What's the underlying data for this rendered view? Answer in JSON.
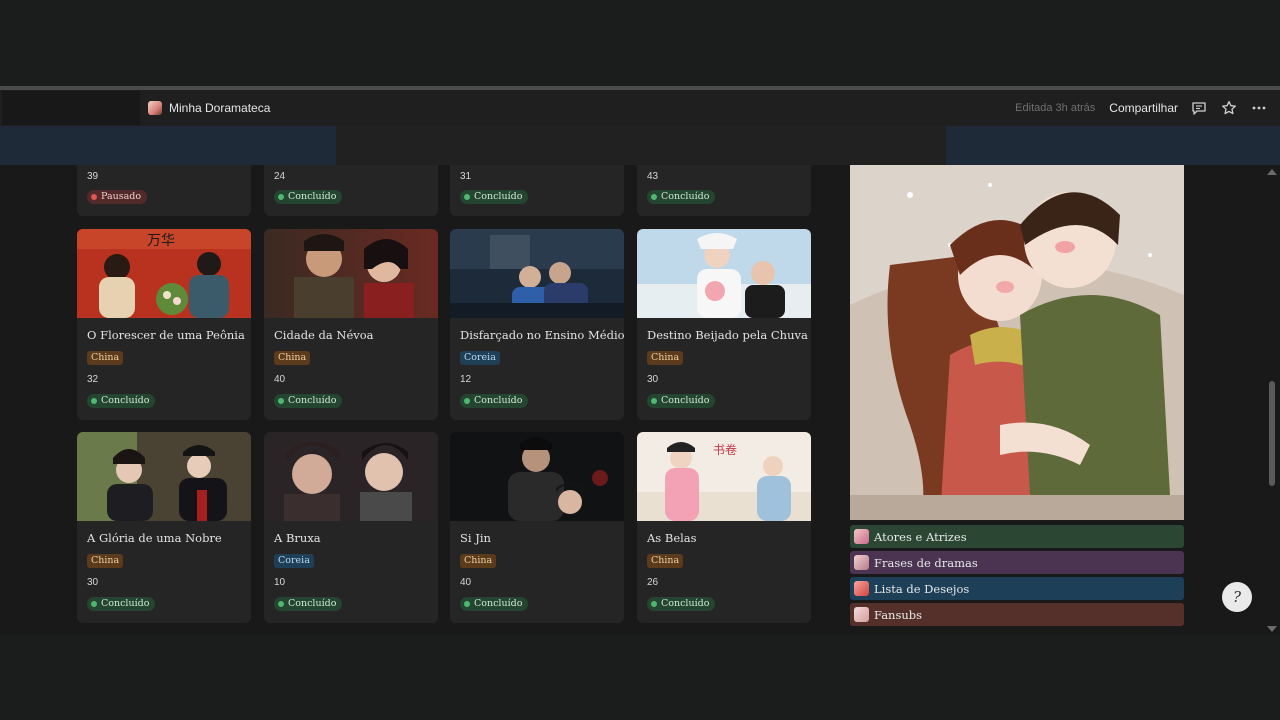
{
  "header": {
    "page_title": "Minha Doramateca",
    "edited": "Editada 3h atrás",
    "share": "Compartilhar"
  },
  "icons": [
    "page-icon",
    "comment-icon",
    "star-icon",
    "more-icon",
    "help-icon"
  ],
  "colors": {
    "status_done": "#24452f",
    "status_paused": "#522a2a",
    "country_china": "#5b3b1c",
    "country_korea": "#1f3f57"
  },
  "partial_cards": [
    {
      "episodes": "39",
      "status": "Pausado"
    },
    {
      "episodes": "24",
      "status": "Concluído"
    },
    {
      "episodes": "31",
      "status": "Concluído"
    },
    {
      "episodes": "43",
      "status": "Concluído"
    }
  ],
  "cards": [
    {
      "title": "O Florescer de uma Peônia",
      "country": "China",
      "episodes": "32",
      "status": "Concluído"
    },
    {
      "title": "Cidade da Névoa",
      "country": "China",
      "episodes": "40",
      "status": "Concluído"
    },
    {
      "title": "Disfarçado no Ensino Médio",
      "country": "Coreia",
      "episodes": "12",
      "status": "Concluído"
    },
    {
      "title": "Destino Beijado pela Chuva",
      "country": "China",
      "episodes": "30",
      "status": "Concluído"
    },
    {
      "title": "A Glória de uma Nobre",
      "country": "China",
      "episodes": "30",
      "status": "Concluído"
    },
    {
      "title": "A Bruxa",
      "country": "Coreia",
      "episodes": "10",
      "status": "Concluído"
    },
    {
      "title": "Si Jin",
      "country": "China",
      "episodes": "40",
      "status": "Concluído"
    },
    {
      "title": "As Belas",
      "country": "China",
      "episodes": "26",
      "status": "Concluído"
    }
  ],
  "sidebar": {
    "links": [
      {
        "label": "Atores e Atrizes",
        "color": "#2b4733"
      },
      {
        "label": "Frases de dramas",
        "color": "#4a3452"
      },
      {
        "label": "Lista de Desejos",
        "color": "#1d4058"
      },
      {
        "label": "Fansubs",
        "color": "#55302b"
      }
    ]
  }
}
